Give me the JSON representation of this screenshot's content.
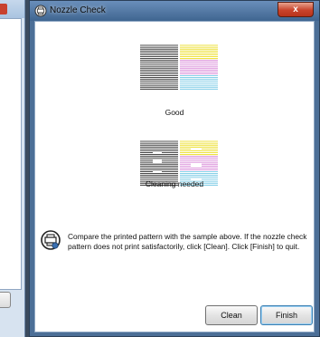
{
  "window": {
    "title": "Nozzle Check",
    "close_glyph": "x"
  },
  "samples": [
    {
      "caption": "Good"
    },
    {
      "caption": "Cleaning needed"
    }
  ],
  "info": {
    "text": "Compare the printed pattern with the sample above. If the nozzle check pattern does not print satisfactorily, click [Clean]. Click [Finish] to quit."
  },
  "buttons": {
    "clean_label": "Clean",
    "finish_label": "Finish"
  },
  "colors": {
    "titlebar": "#4c6f97",
    "close_button": "#c8432b",
    "pattern_black": "#111111",
    "pattern_yellow": "#e8d800",
    "pattern_magenta": "#d070d0",
    "pattern_cyan": "#60c0e0"
  }
}
